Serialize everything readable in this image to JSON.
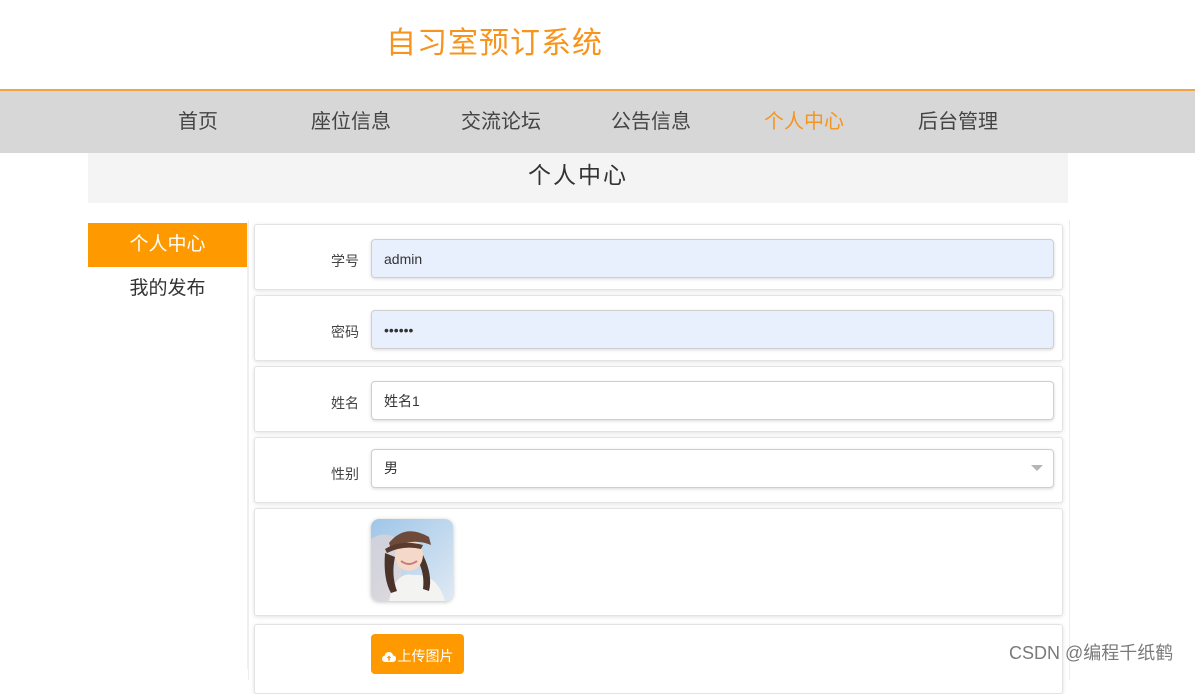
{
  "header": {
    "title": "自习室预订系统"
  },
  "nav": {
    "items": [
      {
        "label": "首页"
      },
      {
        "label": "座位信息"
      },
      {
        "label": "交流论坛"
      },
      {
        "label": "公告信息"
      },
      {
        "label": "个人中心"
      },
      {
        "label": "后台管理"
      }
    ],
    "active": "个人中心"
  },
  "section": {
    "title": "个人中心"
  },
  "side_menu": {
    "items": [
      {
        "label": "个人中心"
      },
      {
        "label": "我的发布"
      }
    ],
    "active": "个人中心"
  },
  "form": {
    "student_id": {
      "label": "学号",
      "value": "admin"
    },
    "password": {
      "label": "密码",
      "value": "123456"
    },
    "name": {
      "label": "姓名",
      "value": "姓名1"
    },
    "gender": {
      "label": "性别",
      "value": "男"
    },
    "upload_label": "上传图片"
  },
  "watermark": "CSDN @编程千纸鹤",
  "colors": {
    "accent": "#ff9900",
    "title": "#f7941d",
    "nav_bg": "#d7d7d7"
  },
  "icons": {
    "upload": "cloud-upload-icon",
    "select": "chevron-down-icon"
  }
}
